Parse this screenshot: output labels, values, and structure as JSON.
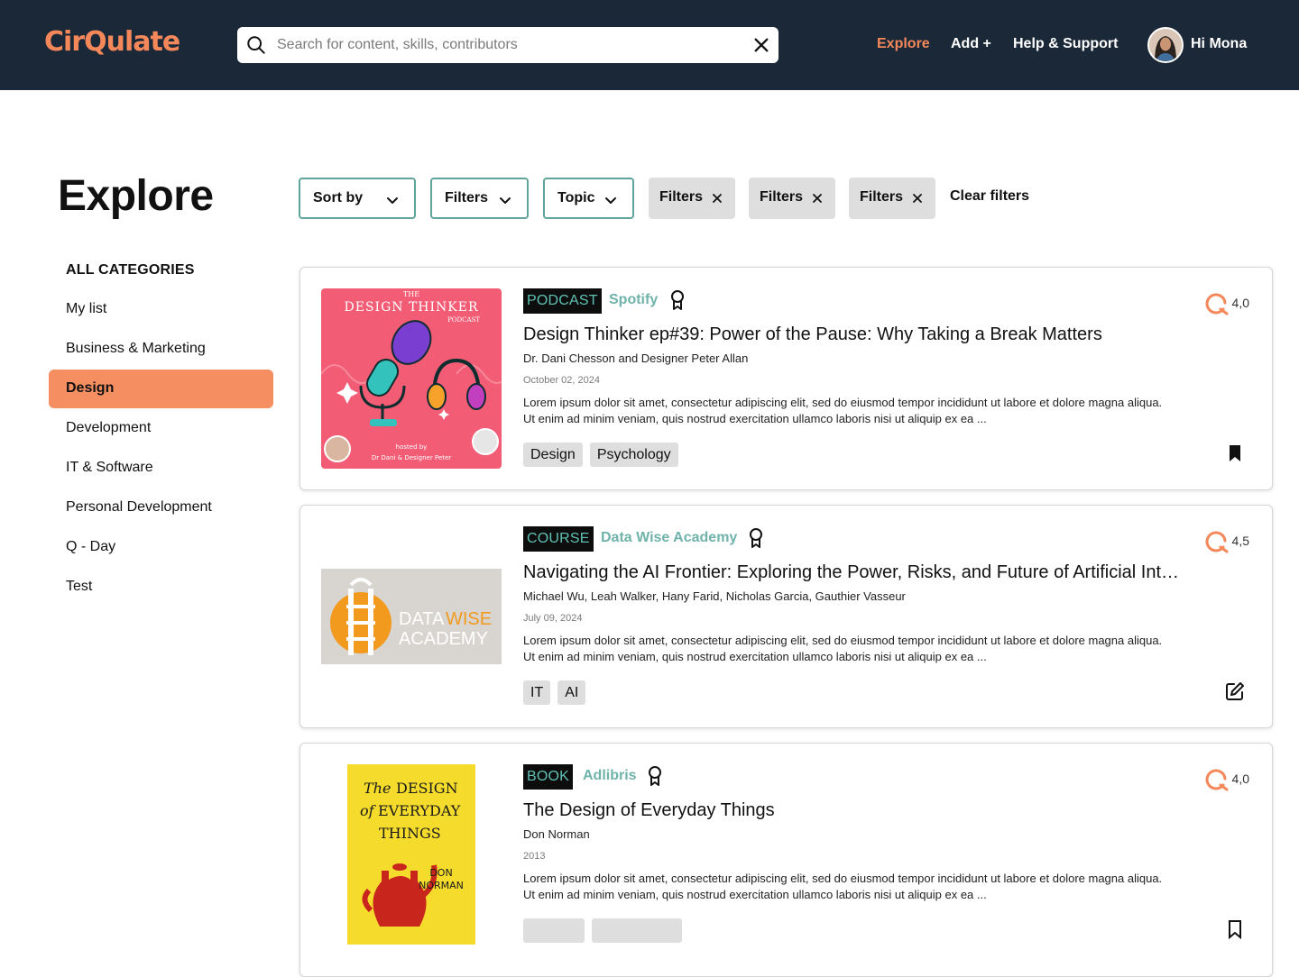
{
  "header": {
    "logo": "CirQulate",
    "search_placeholder": "Search for content, skills, contributors",
    "nav": {
      "explore": "Explore",
      "add": "Add +",
      "help": "Help & Support"
    },
    "greeting": "Hi Mona"
  },
  "page": {
    "title": "Explore"
  },
  "filters": {
    "sort_label": "Sort by",
    "filters_label": "Filters",
    "topic_label": "Topic",
    "active": [
      "Filters",
      "Filters",
      "Filters"
    ],
    "clear_label": "Clear filters"
  },
  "sidebar": {
    "heading": "ALL CATEGORIES",
    "items": [
      {
        "label": "My list"
      },
      {
        "label": "Business & Marketing"
      },
      {
        "label": "Design"
      },
      {
        "label": "Development"
      },
      {
        "label": "IT & Software"
      },
      {
        "label": "Personal Development"
      },
      {
        "label": "Q - Day"
      },
      {
        "label": "Test"
      }
    ],
    "active_item": "Design"
  },
  "cards": [
    {
      "type": "PODCAST",
      "provider": "Spotify",
      "rating": "4,0",
      "title": "Design Thinker ep#39: Power of the Pause: Why Taking a Break Matters",
      "authors": "Dr. Dani Chesson and Designer Peter Allan",
      "date": "October 02, 2024",
      "description": "Lorem ipsum dolor sit amet, consectetur adipiscing elit, sed do eiusmod tempor incididunt ut labore et dolore magna aliqua. Ut enim ad minim veniam, quis nostrud exercitation ullamco laboris nisi ut aliquip ex ea ...",
      "tags": [
        "Design",
        "Psychology"
      ],
      "action_icon": "bookmark-filled-icon",
      "thumb": {
        "line1": "THE",
        "line2": "DESIGN THINKER",
        "line3": "PODCAST",
        "hosted": "hosted by",
        "hosts": "Dr Dani & Designer Peter"
      }
    },
    {
      "type": "COURSE",
      "provider": "Data Wise Academy",
      "rating": "4,5",
      "title": "Navigating the AI Frontier: Exploring the Power, Risks, and Future of Artificial Intelligence",
      "authors": "Michael Wu, Leah Walker, Hany Farid, Nicholas Garcia, Gauthier Vasseur",
      "date": "July 09, 2024",
      "description": "Lorem ipsum dolor sit amet, consectetur adipiscing elit, sed do eiusmod tempor incididunt ut labore et dolore magna aliqua. Ut enim ad minim veniam, quis nostrud exercitation ullamco laboris nisi ut aliquip ex ea ...",
      "tags": [
        "IT",
        "AI"
      ],
      "action_icon": "edit-icon",
      "thumb": {
        "word1a": "DATA",
        "word1b": "WISE",
        "word2": "ACADEMY"
      }
    },
    {
      "type": "BOOK",
      "provider": "Adlibris",
      "rating": "4,0",
      "title": "The Design of Everyday Things",
      "authors": "Don Norman",
      "date": "2013",
      "description": "Lorem ipsum dolor sit amet, consectetur adipiscing elit, sed do eiusmod tempor incididunt ut labore et dolore magna aliqua. Ut enim ad minim veniam, quis nostrud exercitation ullamco laboris nisi ut aliquip ex ea ...",
      "tags": [
        "",
        ""
      ],
      "action_icon": "bookmark-outline-icon",
      "thumb": {
        "the": "The",
        "design": "DESIGN",
        "of": "of",
        "everyday": "EVERYDAY",
        "things": "THINGS",
        "author1": "DON",
        "author2": "NORMAN"
      }
    }
  ],
  "colors": {
    "header_bg": "#1b2838",
    "accent": "#f4885a",
    "teal": "#5fa39a",
    "active_category_bg": "#f58f62"
  }
}
